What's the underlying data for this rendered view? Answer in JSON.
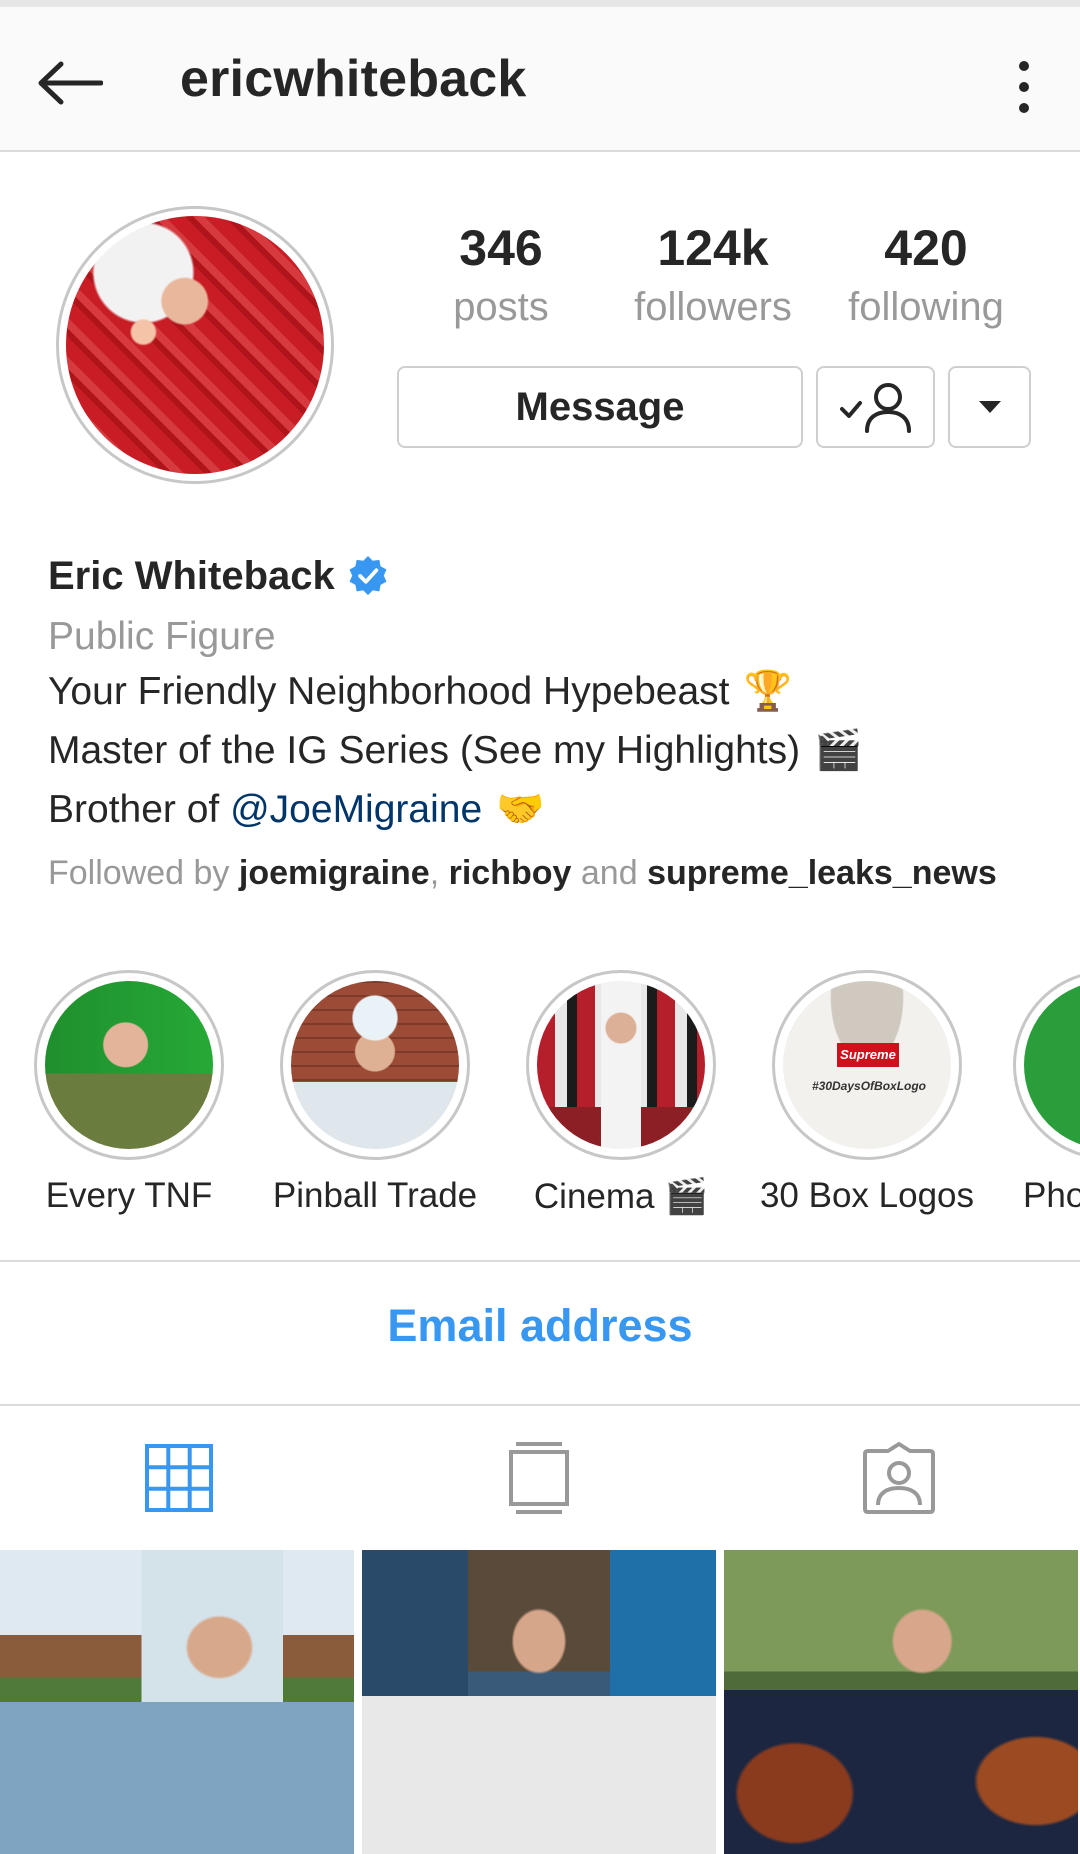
{
  "header": {
    "username": "ericwhiteback"
  },
  "profile": {
    "stats": [
      {
        "value": "346",
        "label": "posts"
      },
      {
        "value": "124k",
        "label": "followers"
      },
      {
        "value": "420",
        "label": "following"
      }
    ],
    "buttons": {
      "message_label": "Message"
    },
    "display_name": "Eric Whiteback",
    "verified": true,
    "category": "Public Figure",
    "bio": {
      "line1": "Your Friendly Neighborhood Hypebeast",
      "line1_emoji": "🏆",
      "line2": "Master of the IG Series (See my Highlights)",
      "line2_emoji": "🎬",
      "line3_prefix": "Brother of ",
      "line3_mention": "@JoeMigraine",
      "line3_emoji": "🤝"
    },
    "followed_by": {
      "prefix": "Followed by ",
      "users": [
        "joemigraine",
        "richboy",
        "supreme_leaks_news"
      ],
      "separator": ", ",
      "conjunction": " and "
    }
  },
  "highlights": [
    {
      "label": "Every TNF"
    },
    {
      "label": "Pinball Trade"
    },
    {
      "label": "Cinema",
      "emoji": "🎬"
    },
    {
      "label": "30 Box Logos",
      "image_text": {
        "logo": "Supreme",
        "hashtag": "#30DaysOfBoxLogo"
      }
    },
    {
      "label": "Pho"
    }
  ],
  "contact": {
    "email_label": "Email address"
  },
  "tabs": [
    {
      "icon": "grid-icon",
      "active": true
    },
    {
      "icon": "feed-icon",
      "active": false
    },
    {
      "icon": "tagged-icon",
      "active": false
    }
  ],
  "colors": {
    "accent": "#3897f0",
    "mention": "#003569",
    "secondary_text": "#999999",
    "primary_text": "#262626",
    "divider": "#dbdbdb"
  }
}
